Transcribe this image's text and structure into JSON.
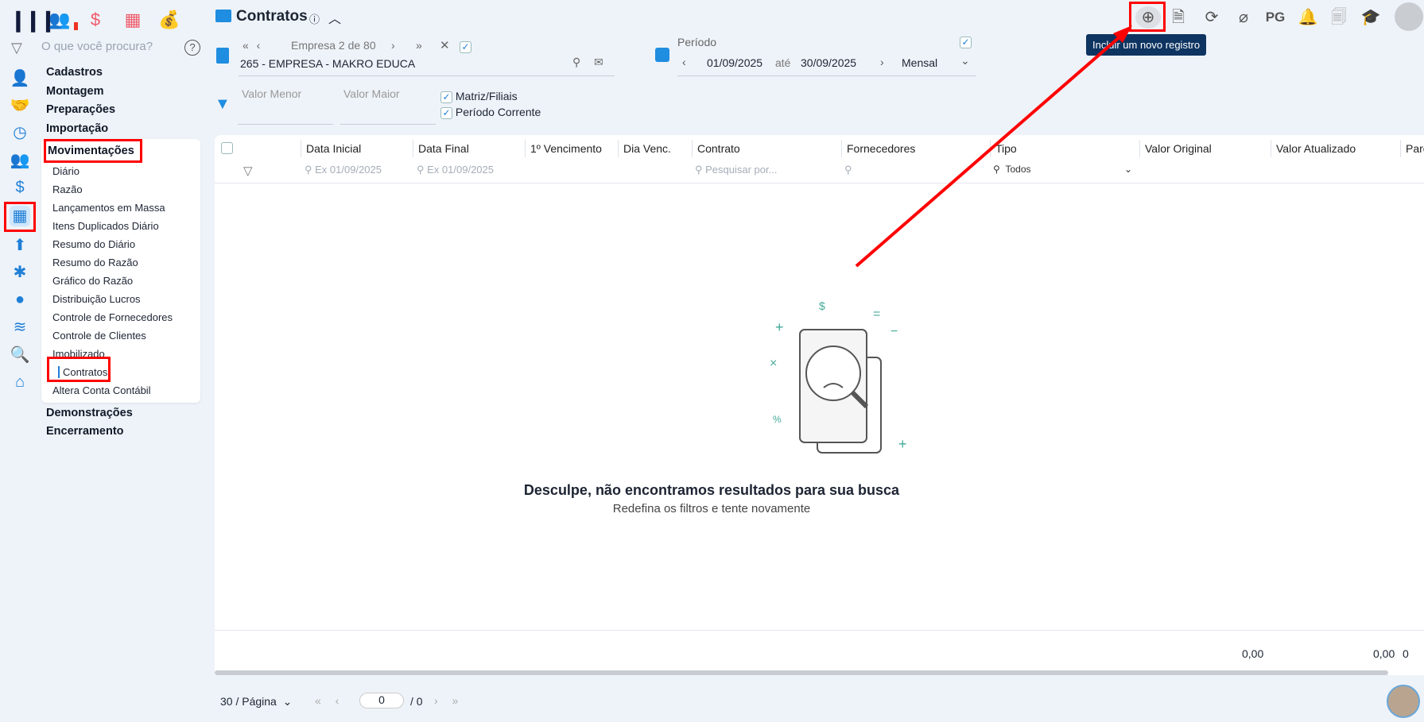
{
  "app": {
    "logo": "M",
    "search_placeholder": "O que você procura?"
  },
  "menu": {
    "top": [
      "Cadastros",
      "Montagem",
      "Preparações",
      "Importação",
      "Movimentações"
    ],
    "sub": [
      "Diário",
      "Razão",
      "Lançamentos em Massa",
      "Itens Duplicados Diário",
      "Resumo do Diário",
      "Resumo do Razão",
      "Gráfico do Razão",
      "Distribuição Lucros",
      "Controle de Fornecedores",
      "Controle de Clientes",
      "Imobilizado",
      "Contratos",
      "Altera Conta Contábil"
    ],
    "bottom": [
      "Demonstrações",
      "Encerramento"
    ]
  },
  "header": {
    "title": "Contratos",
    "info": "ⓘ",
    "pg": "PG",
    "tooltip": "Incluir um novo registro"
  },
  "empresa": {
    "nav": "Empresa 2 de 80",
    "name": "265 - EMPRESA - MAKRO EDUCA"
  },
  "periodo": {
    "label": "Período",
    "start": "01/09/2025",
    "sep": "até",
    "end": "30/09/2025",
    "mode": "Mensal"
  },
  "filters": {
    "valor_menor": "Valor Menor",
    "valor_maior": "Valor Maior",
    "matriz": "Matriz/Filiais",
    "periodo_corrente": "Período Corrente"
  },
  "table": {
    "columns": [
      "Data Inicial",
      "Data Final",
      "1º Vencimento",
      "Dia Venc.",
      "Contrato",
      "Fornecedores",
      "Tipo",
      "Valor Original",
      "Valor Atualizado",
      "Parc"
    ],
    "date_ph": "Ex 01/09/2025",
    "search_ph": "Pesquisar por...",
    "tipo": "Todos",
    "empty_title": "Desculpe, não encontramos resultados para sua busca",
    "empty_sub": "Redefina os filtros e tente novamente",
    "total_original": "0,00",
    "total_atualizado": "0,00",
    "total_parc": "0"
  },
  "pager": {
    "per_page": "30 / Página",
    "page": "0",
    "total": "/ 0"
  }
}
